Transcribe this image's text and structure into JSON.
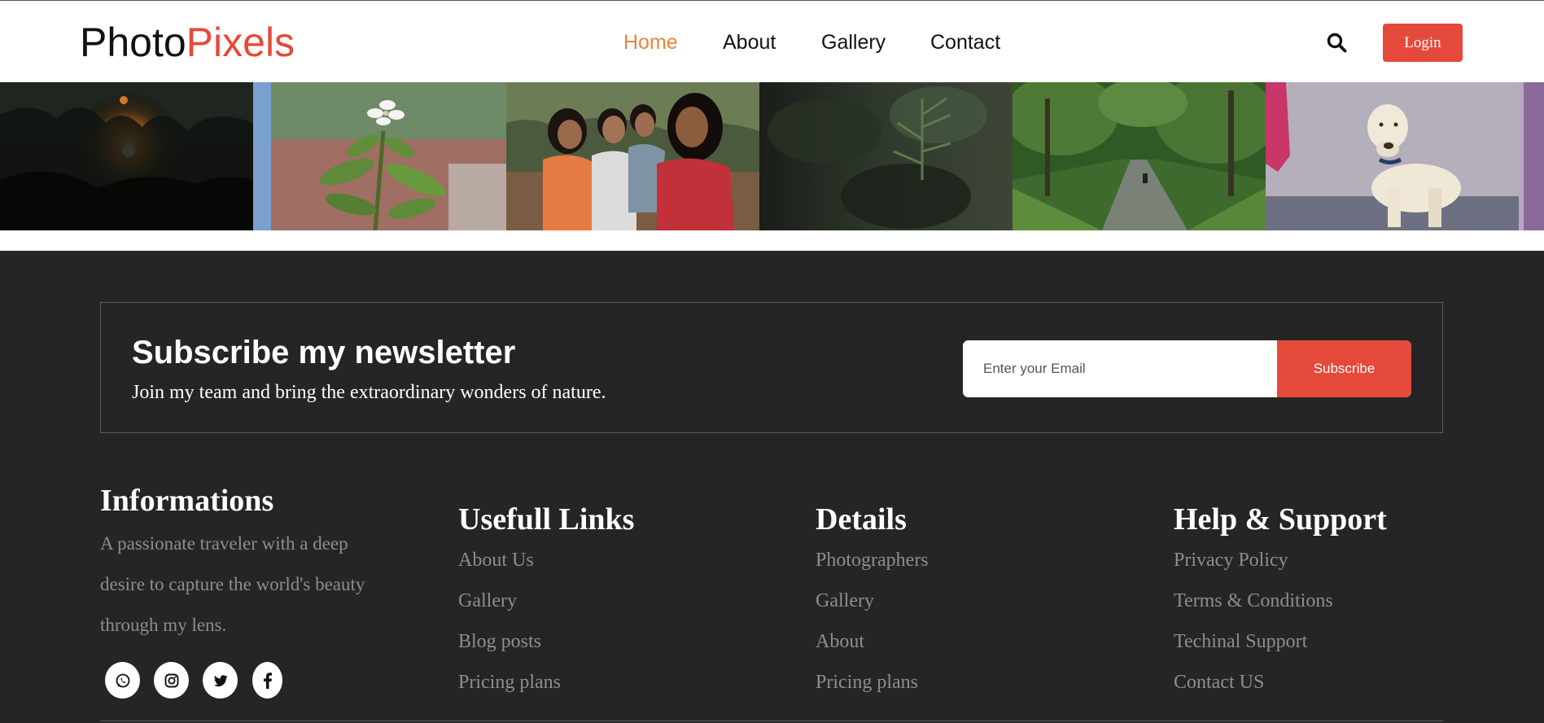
{
  "header": {
    "logo": {
      "part1": "Photo",
      "part2": "Pixels"
    },
    "nav": [
      {
        "label": "Home",
        "active": true
      },
      {
        "label": "About",
        "active": false
      },
      {
        "label": "Gallery",
        "active": false
      },
      {
        "label": "Contact",
        "active": false
      }
    ],
    "search_icon": "search-icon",
    "login_label": "Login"
  },
  "gallery": {
    "photos": [
      "sunset-through-trees",
      "white-flower-plant",
      "three-children",
      "blurred-foliage",
      "forest-road",
      "white-labrador-dog"
    ]
  },
  "newsletter": {
    "title": "Subscribe my newsletter",
    "subtitle": "Join my team and bring the extraordinary wonders of nature.",
    "email_placeholder": "Enter your Email",
    "subscribe_label": "Subscribe"
  },
  "footer": {
    "informations": {
      "title": "Informations",
      "text": "A passionate traveler with a deep desire to capture the world's beauty through my lens.",
      "socials": [
        "whatsapp-icon",
        "instagram-icon",
        "twitter-icon",
        "facebook-icon"
      ]
    },
    "useful_links": {
      "title": "Usefull Links",
      "items": [
        "About Us",
        "Gallery",
        "Blog posts",
        "Pricing plans"
      ]
    },
    "details": {
      "title": "Details",
      "items": [
        "Photographers",
        "Gallery",
        "About",
        "Pricing plans"
      ]
    },
    "help": {
      "title": "Help & Support",
      "items": [
        "Privacy Policy",
        "Terms & Conditions",
        "Techinal Support",
        "Contact US"
      ]
    }
  },
  "colors": {
    "accent": "#e5493a",
    "nav_active": "#e8853a",
    "footer_bg": "#252525",
    "muted_text": "#8d8d8d"
  }
}
